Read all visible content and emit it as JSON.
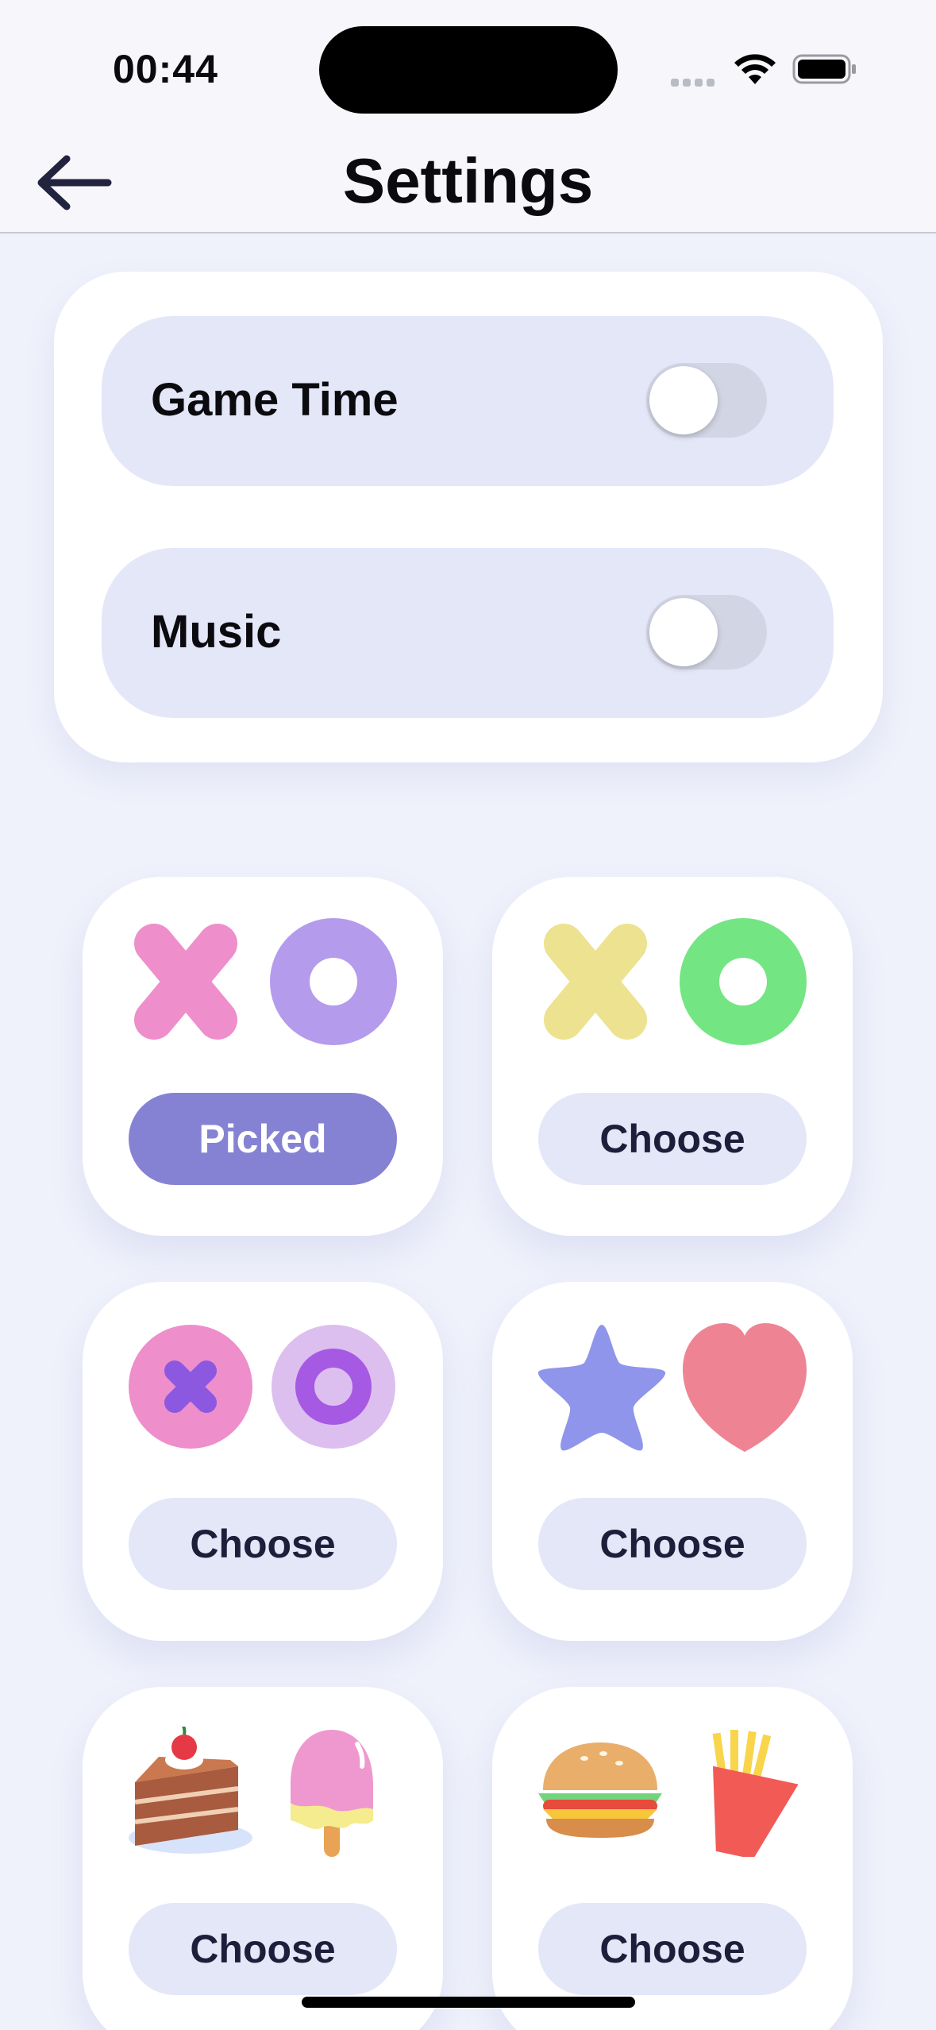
{
  "status_bar": {
    "time": "00:44"
  },
  "nav": {
    "title": "Settings",
    "back_icon": "arrow-left-icon"
  },
  "settings": [
    {
      "label": "Game Time",
      "enabled": false
    },
    {
      "label": "Music",
      "enabled": false
    }
  ],
  "themes": [
    {
      "icons": [
        "x-icon",
        "o-icon"
      ],
      "colors": [
        "#ee8ecb",
        "#b49bec"
      ],
      "button": "Picked",
      "picked": true
    },
    {
      "icons": [
        "x-icon",
        "o-icon"
      ],
      "colors": [
        "#ede28f",
        "#74e583"
      ],
      "button": "Choose",
      "picked": false
    },
    {
      "icons": [
        "x-circle-icon",
        "o-circle-icon"
      ],
      "colors": [
        "#ee8ecb",
        "#dcbfee"
      ],
      "button": "Choose",
      "picked": false
    },
    {
      "icons": [
        "star-icon",
        "heart-icon"
      ],
      "colors": [
        "#8f95ea",
        "#ee8493"
      ],
      "button": "Choose",
      "picked": false
    },
    {
      "icons": [
        "cake-icon",
        "ice-cream-icon"
      ],
      "colors": [
        "#a85b3e",
        "#ef98cf"
      ],
      "button": "Choose",
      "picked": false
    },
    {
      "icons": [
        "burger-icon",
        "fries-icon"
      ],
      "colors": [
        "#e9ae6a",
        "#f25a55"
      ],
      "button": "Choose",
      "picked": false
    }
  ]
}
